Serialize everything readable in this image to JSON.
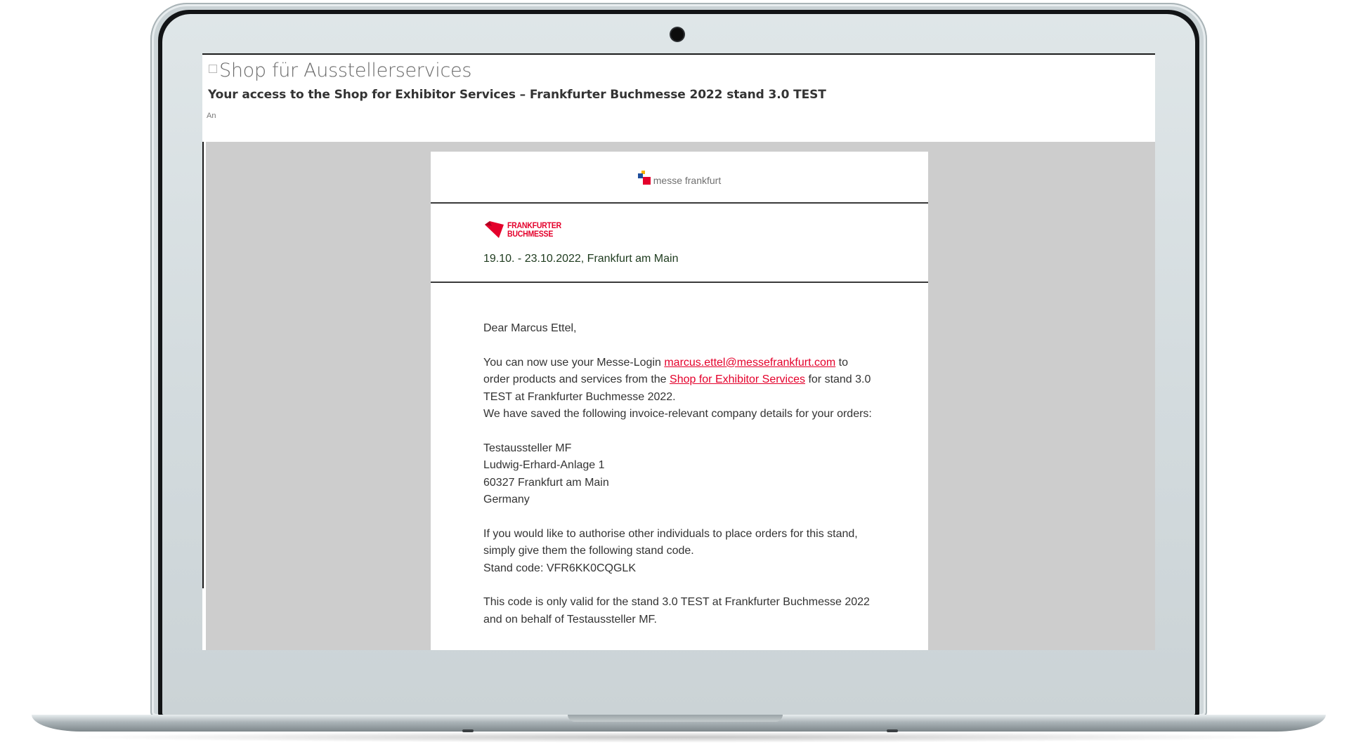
{
  "window": {
    "subject_title": "Shop für Ausstellerservices",
    "subtitle": "Your access to the Shop for Exhibitor Services – Frankfurter Buchmesse 2022 stand 3.0 TEST",
    "to_label": "An"
  },
  "email": {
    "brand_mf": "messe frankfurt",
    "fb_line1": "FRANKFURTER",
    "fb_line2": "BUCHMESSE",
    "event_dates": "19.10. - 23.10.2022, Frankfurt am Main",
    "greeting": "Dear Marcus Ettel,",
    "p1_a": "You can now use your Messe-Login ",
    "login_email": "marcus.ettel@messefrankfurt.com",
    "p1_b": " to order products and services from the ",
    "shop_link": "Shop for Exhibitor Services",
    "p1_c": " for stand 3.0 TEST at Frankfurter Buchmesse 2022.",
    "p2": "We have saved the following invoice-relevant company details for your orders:",
    "company": "Testaussteller MF",
    "street": "Ludwig-Erhard-Anlage 1",
    "city": "60327 Frankfurt am Main",
    "country": "Germany",
    "p3": "If you would like to authorise other individuals to place orders for this stand, simply give them the following stand code.",
    "stand_code": "Stand code: VFR6KK0CQGLK",
    "p4": "This code is only valid for the stand 3.0 TEST at Frankfurter Buchmesse 2022 and on behalf of Testaussteller MF."
  },
  "colors": {
    "brand_red": "#e4002b",
    "canvas_gray": "#cdcdcd"
  }
}
